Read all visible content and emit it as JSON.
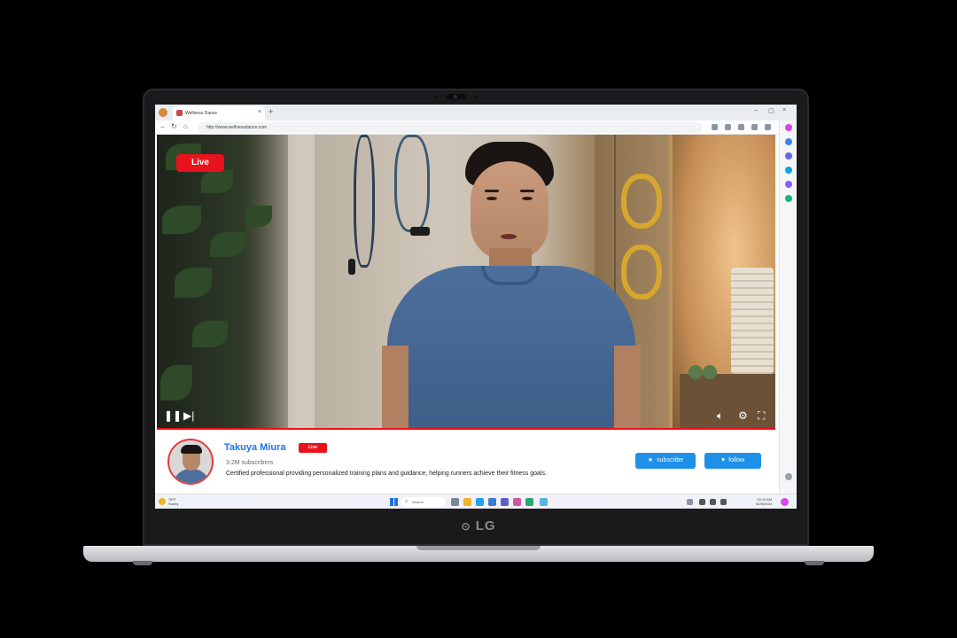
{
  "browser": {
    "tab_title": "Wellness Dance",
    "url": "http://www.wellnessdance.com"
  },
  "video": {
    "live_badge": "Live"
  },
  "channel": {
    "name": "Takuya Miura",
    "live_label": "Live",
    "subscribers": "3.2M subscribers",
    "description": "Certified professional providing personalized training plans and guidance, helping runners achieve their fitness goals.",
    "subscribe_label": "subscribe",
    "follow_label": "follow"
  },
  "taskbar": {
    "weather_temp": "78°F",
    "weather_text": "Sunny",
    "search_placeholder": "Search",
    "time": "10:11 AM",
    "date": "6/25/2024"
  },
  "laptop": {
    "brand": "LG"
  },
  "colors": {
    "live_red": "#e8121c",
    "accent_blue": "#1e90e8",
    "channel_name_blue": "#1a73e8"
  }
}
